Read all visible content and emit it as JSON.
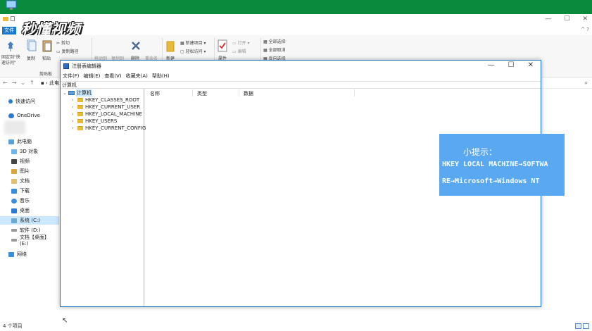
{
  "watermark": "秒懂视频",
  "explorer": {
    "close_glyph": "✕",
    "minimize_glyph": "—",
    "maximize_glyph": "☐",
    "file_tab": "文件",
    "ribbon": {
      "pin_label": "固定到\"快速访问\"",
      "copy_label": "复制",
      "paste_label": "粘贴",
      "cut_label": "剪切",
      "copy_path_label": "复制路径",
      "clipboard_group": "剪贴板",
      "move_to_label": "移动到",
      "copy_to_label": "复制到",
      "delete_label": "删除",
      "rename_label": "重命名",
      "new_folder_label": "新建",
      "new_item_label": "新建项目",
      "easy_access_label": "轻松访问",
      "properties_label": "属性",
      "open_label": "打开",
      "edit_label": "编辑",
      "select_all_label": "全部选择",
      "select_none_label": "全部取消",
      "invert_label": "反向选择"
    },
    "address_crumb": "此电",
    "nav": {
      "quick_access": "快速访问",
      "onedrive": "OneDrive",
      "this_pc": "此电脑",
      "objects3d": "3D 对象",
      "videos": "视频",
      "pictures": "图片",
      "documents": "文档",
      "downloads": "下载",
      "music": "音乐",
      "desktop": "桌面",
      "drive_c": "系统 (C:)",
      "drive_d": "软件 (D:)",
      "drive_e": "文档【桌面】 (E:)",
      "network": "网络"
    },
    "status": "4 个项目"
  },
  "regedit": {
    "title": "注册表编辑器",
    "controls": {
      "minimize": "—",
      "maximize": "☐",
      "close": "✕"
    },
    "menu": [
      "文件(F)",
      "编辑(E)",
      "查看(V)",
      "收藏夹(A)",
      "帮助(H)"
    ],
    "address": "计算机",
    "tree": {
      "root": "计算机",
      "children": [
        "HKEY_CLASSES_ROOT",
        "HKEY_CURRENT_USER",
        "HKEY_LOCAL_MACHINE",
        "HKEY_USERS",
        "HKEY_CURRENT_CONFIG"
      ]
    },
    "columns": [
      "名称",
      "类型",
      "数据"
    ]
  },
  "tip": {
    "title": "小提示：",
    "line1": "HKEY LOCAL MACHINE→SOFTWA",
    "line2": "RE→Microsoft→Windows NT",
    "color": "#5aa8f0"
  },
  "colors": {
    "accent": "#1979ca",
    "green_band": "#0a8a3c",
    "selected": "#cce8ff"
  }
}
